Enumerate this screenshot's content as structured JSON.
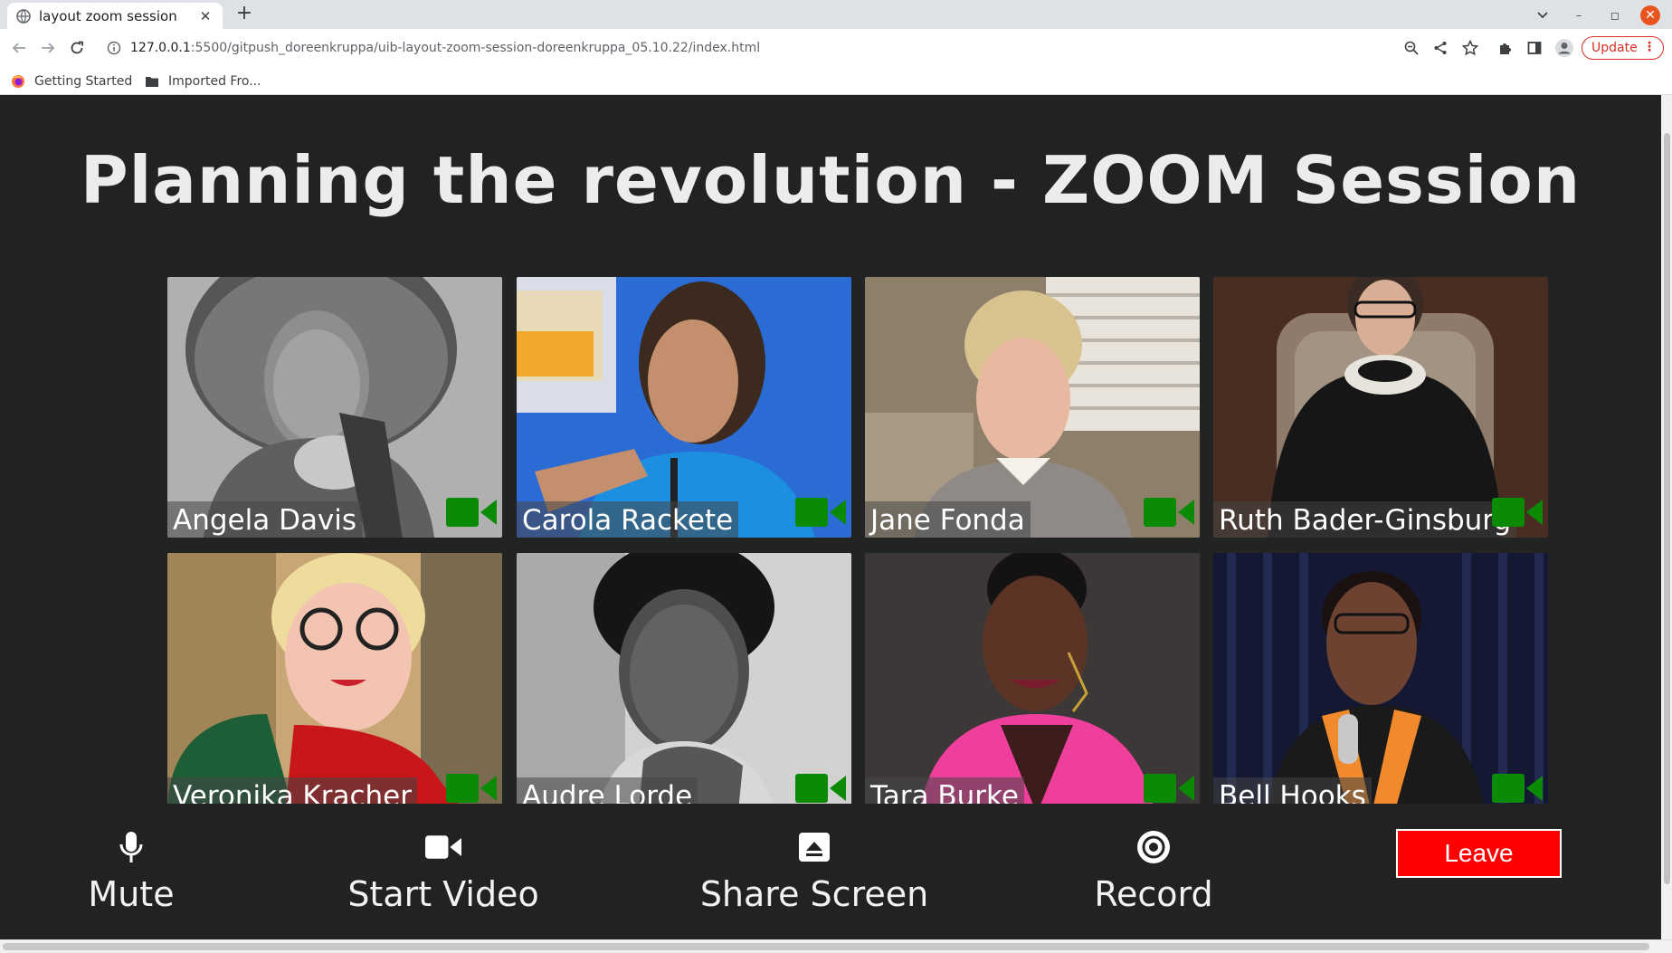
{
  "browser": {
    "tab_title": "layout zoom session",
    "tab_close": "✕",
    "new_tab": "+",
    "url_host": "127.0.0.1",
    "url_path": ":5500/gitpush_doreenkruppa/uib-layout-zoom-session-doreenkruppa_05.10.22/index.html",
    "update_label": "Update",
    "update_menu": "⋮",
    "bookmarks": [
      {
        "label": "Getting Started",
        "icon": "firefox-icon"
      },
      {
        "label": "Imported Fro...",
        "icon": "folder-icon"
      }
    ],
    "window_controls": {
      "minimize": "–",
      "restore": "◻",
      "close": "✕"
    }
  },
  "page": {
    "title": "Planning the revolution - ZOOM Session",
    "participants": [
      {
        "name": "Angela Davis",
        "camera_on": true
      },
      {
        "name": "Carola Rackete",
        "camera_on": true
      },
      {
        "name": "Jane Fonda",
        "camera_on": true
      },
      {
        "name": "Ruth Bader-Ginsburg",
        "camera_on": true
      },
      {
        "name": "Veronika Kracher",
        "camera_on": true
      },
      {
        "name": "Audre Lorde",
        "camera_on": true
      },
      {
        "name": "Tara Burke",
        "camera_on": true
      },
      {
        "name": "Bell Hooks",
        "camera_on": true
      }
    ],
    "controls": {
      "mute": "Mute",
      "start_video": "Start Video",
      "share_screen": "Share Screen",
      "record": "Record",
      "leave": "Leave"
    }
  },
  "colors": {
    "page_bg": "#212422",
    "bar_bg": "#222222",
    "camera_green": "#0b8a06",
    "leave_red": "#ff0000",
    "update_red": "#d93025"
  }
}
